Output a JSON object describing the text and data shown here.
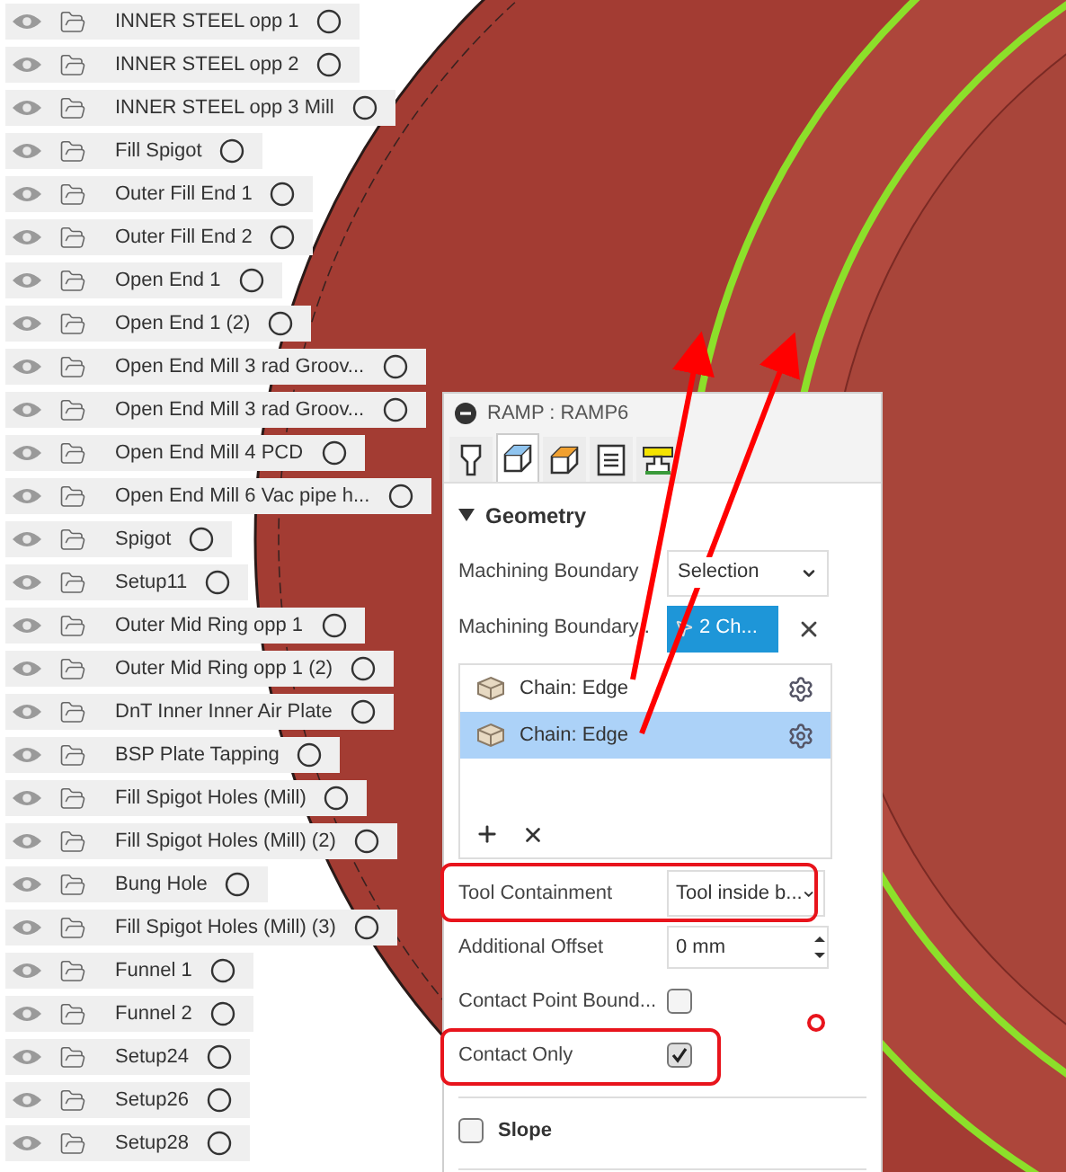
{
  "browser": {
    "items": [
      {
        "name": "INNER STEEL opp 1"
      },
      {
        "name": "INNER STEEL opp 2"
      },
      {
        "name": "INNER STEEL opp 3 Mill"
      },
      {
        "name": "Fill Spigot"
      },
      {
        "name": "Outer Fill End 1"
      },
      {
        "name": "Outer Fill End 2"
      },
      {
        "name": "Open End 1"
      },
      {
        "name": "Open End 1 (2)"
      },
      {
        "name": "Open End Mill 3 rad Groov..."
      },
      {
        "name": "Open End Mill 3 rad Groov..."
      },
      {
        "name": "Open End Mill 4 PCD"
      },
      {
        "name": "Open End Mill 6 Vac pipe h..."
      },
      {
        "name": "Spigot"
      },
      {
        "name": "Setup11"
      },
      {
        "name": "Outer Mid Ring opp 1"
      },
      {
        "name": "Outer Mid Ring opp 1 (2)"
      },
      {
        "name": "DnT Inner Inner Air Plate"
      },
      {
        "name": "BSP Plate Tapping"
      },
      {
        "name": "Fill Spigot Holes (Mill)"
      },
      {
        "name": "Fill Spigot Holes (Mill) (2)"
      },
      {
        "name": "Bung Hole"
      },
      {
        "name": "Fill Spigot Holes (Mill) (3)"
      },
      {
        "name": "Funnel 1"
      },
      {
        "name": "Funnel 2"
      },
      {
        "name": "Setup24"
      },
      {
        "name": "Setup26"
      },
      {
        "name": "Setup28"
      }
    ]
  },
  "panel": {
    "title": "RAMP : RAMP6",
    "tabs": [
      {
        "kind": "tool",
        "selected": false
      },
      {
        "kind": "geometry",
        "selected": true
      },
      {
        "kind": "heights",
        "selected": false
      },
      {
        "kind": "passes",
        "selected": false
      },
      {
        "kind": "linking",
        "selected": false
      }
    ],
    "section": {
      "title": "Geometry",
      "expanded": true
    },
    "boundary_mode": {
      "label": "Machining Boundary",
      "value": "Selection"
    },
    "boundary_selection": {
      "label": "Machining Boundary .",
      "button": "2 Ch..."
    },
    "chains": [
      {
        "label": "Chain: Edge",
        "selected": false
      },
      {
        "label": "Chain: Edge",
        "selected": true
      }
    ],
    "tool_containment": {
      "label": "Tool Containment",
      "value": "Tool inside b..."
    },
    "additional_offset": {
      "label": "Additional Offset",
      "value": "0 mm"
    },
    "contact_point_boundary": {
      "label": "Contact Point Bound...",
      "checked": false
    },
    "contact_only": {
      "label": "Contact Only",
      "checked": true
    },
    "slope": {
      "label": "Slope",
      "checked": false
    }
  }
}
